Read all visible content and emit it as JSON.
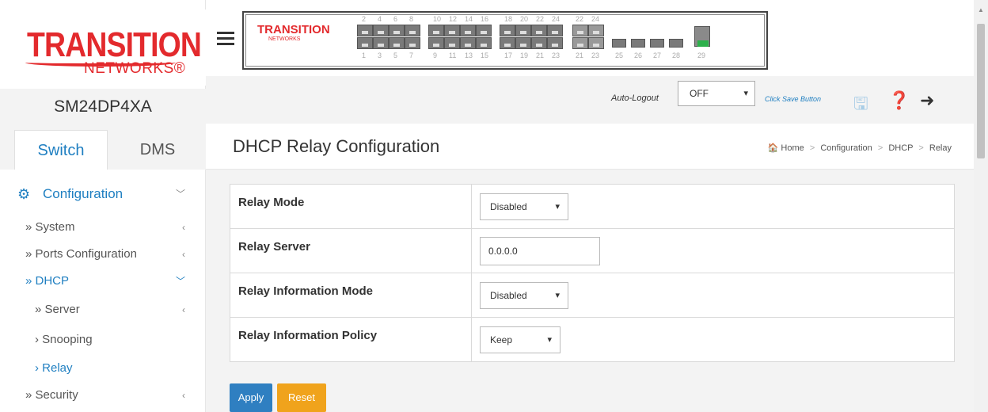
{
  "brand": {
    "logo_top": "TRANSITION",
    "logo_bottom": "NETWORKS",
    "device_name": "SM24DP4XA"
  },
  "side_tabs": {
    "switch": "Switch",
    "dms": "DMS"
  },
  "nav": {
    "configuration": "Configuration",
    "items": {
      "system": "» System",
      "ports": "» Ports Configuration",
      "dhcp": "» DHCP",
      "server": "» Server",
      "snooping": "› Snooping",
      "relay": "› Relay",
      "security": "» Security"
    }
  },
  "front_panel": {
    "logo": "TRANSITION",
    "logo_sub": "NETWORKS",
    "top_numbers": [
      "2",
      "4",
      "6",
      "8",
      "10",
      "12",
      "14",
      "16",
      "18",
      "20",
      "22",
      "24",
      "22",
      "24"
    ],
    "bottom_numbers": [
      "1",
      "3",
      "5",
      "7",
      "9",
      "11",
      "13",
      "15",
      "17",
      "19",
      "21",
      "23",
      "21",
      "23",
      "25",
      "26",
      "27",
      "28",
      "29"
    ]
  },
  "toolbar": {
    "auto_logout_label": "Auto-Logout",
    "auto_logout_value": "OFF",
    "click_save": "Click Save Button"
  },
  "page": {
    "title": "DHCP Relay Configuration",
    "breadcrumb": [
      "Home",
      "Configuration",
      "DHCP",
      "Relay"
    ]
  },
  "form": {
    "relay_mode": {
      "label": "Relay Mode",
      "value": "Disabled"
    },
    "relay_server": {
      "label": "Relay Server",
      "value": "0.0.0.0"
    },
    "relay_info_mode": {
      "label": "Relay Information Mode",
      "value": "Disabled"
    },
    "relay_info_policy": {
      "label": "Relay Information Policy",
      "value": "Keep"
    }
  },
  "buttons": {
    "apply": "Apply",
    "reset": "Reset"
  },
  "colors": {
    "brand_red": "#e32a2d",
    "accent_blue": "#1f7fc1",
    "apply_blue": "#2f7fc1",
    "reset_orange": "#f0a31c"
  }
}
